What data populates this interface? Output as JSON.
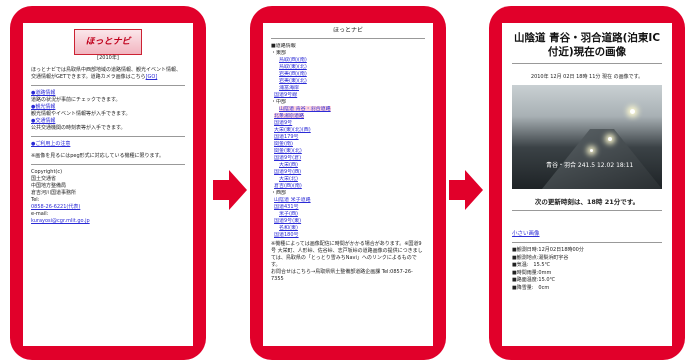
{
  "phone1": {
    "logo_text": "ほっとナビ",
    "date": "[2010年]",
    "intro": "ほっとナビでは鳥取県中西部地域の道路情報、観光イベント情報、交通情報がGETできます。道路カメラ画像はこちら",
    "intro_link": "[GO]",
    "items": [
      {
        "head": "●道路情報",
        "text": "道路の状況が事前にチェックできます。"
      },
      {
        "head": "●観光情報",
        "text": "観光情報やイベント情報等が入手できます。"
      },
      {
        "head": "●交通情報",
        "text": "公共交通機関の時刻表等が入手できます。"
      }
    ],
    "notice_link": "●ご利用上の注意",
    "note": "※画像を見るにはpeg形式に対応している機種に限ります。",
    "copyright_label": "Copyright(c)",
    "org": [
      "国土交通省",
      "中国地方整備局",
      "倉吉河川国道事務所"
    ],
    "tel_label": "Tel:",
    "tel": "0858-26-6221(代表)",
    "email_label": "e-mail:",
    "email": "kurayosi@cgr.mlit.go.jp"
  },
  "phone2": {
    "title": "ほっとナビ",
    "lines": [
      {
        "t": "■道路情報",
        "link": false,
        "indent": 0,
        "sel": false
      },
      {
        "t": "・東部",
        "link": false,
        "indent": 0,
        "sel": false
      },
      {
        "t": "鳥取(西)(南)",
        "link": true,
        "indent": 2,
        "sel": false
      },
      {
        "t": "鳥取(東)(北)",
        "link": true,
        "indent": 2,
        "sel": false
      },
      {
        "t": "岩美(西)(南)",
        "link": true,
        "indent": 2,
        "sel": false
      },
      {
        "t": "岩美(東)(北)",
        "link": true,
        "indent": 2,
        "sel": false
      },
      {
        "t": "浦富海岸",
        "link": true,
        "indent": 2,
        "sel": false
      },
      {
        "t": "国道9号線",
        "link": true,
        "indent": 1,
        "sel": false
      },
      {
        "t": "・中部",
        "link": false,
        "indent": 0,
        "sel": false
      },
      {
        "t": "山陰道 青谷・羽合道路",
        "link": true,
        "indent": 2,
        "sel": true
      },
      {
        "t": "北条湯原道路",
        "link": true,
        "indent": 1,
        "sel": true
      },
      {
        "t": "国道9号",
        "link": true,
        "indent": 1,
        "sel": false
      },
      {
        "t": "大栄(東)(北)(西)",
        "link": true,
        "indent": 1,
        "sel": false
      },
      {
        "t": "国道179号",
        "link": true,
        "indent": 1,
        "sel": false
      },
      {
        "t": "関金(南)",
        "link": true,
        "indent": 1,
        "sel": false
      },
      {
        "t": "関金(東)(北)",
        "link": true,
        "indent": 1,
        "sel": false
      },
      {
        "t": "国道9号(倉)",
        "link": true,
        "indent": 1,
        "sel": false
      },
      {
        "t": "大栄(西)",
        "link": true,
        "indent": 2,
        "sel": false
      },
      {
        "t": "国道9号(西)",
        "link": true,
        "indent": 1,
        "sel": false
      },
      {
        "t": "大栄(北)",
        "link": true,
        "indent": 2,
        "sel": false
      },
      {
        "t": "倉吉(西)(南)",
        "link": true,
        "indent": 1,
        "sel": false
      },
      {
        "t": "・西部",
        "link": false,
        "indent": 0,
        "sel": false
      },
      {
        "t": "山陰道 米子道路",
        "link": true,
        "indent": 1,
        "sel": false
      },
      {
        "t": "国道431号",
        "link": true,
        "indent": 1,
        "sel": false
      },
      {
        "t": "米子(西)",
        "link": true,
        "indent": 2,
        "sel": false
      },
      {
        "t": "国道9号(東)",
        "link": true,
        "indent": 1,
        "sel": false
      },
      {
        "t": "名和(東)",
        "link": true,
        "indent": 2,
        "sel": false
      },
      {
        "t": "国道180号",
        "link": true,
        "indent": 1,
        "sel": false
      }
    ],
    "note": "※機種によっては画像配信に時間がかかる場合があります。※国道9号 大栄町、人形峠、佐谷峠、志戸坂峠の道路画像の提供につきましては、鳥取県の「とっとり雪みちNavi」へのリンクによるものです。",
    "contact": "お問合せはこちら→鳥取県県土整備部道路企画課 Tel:0857-26-7355"
  },
  "phone3": {
    "title": "山陰道 青谷・羽合道路(泊東IC付近)現在の画像",
    "timestamp": "2010年 12月 02日 18時 11分 現在 の画像です。",
    "cam_stamp": "青谷・羽合 241.5 12.02 18:11",
    "next_update": "次の更新時刻は、18時 21分です。",
    "small_link": "小さい画像",
    "info": [
      "■観測日時:12月02日18時00分",
      "■観測地点:湯梨浜町宇谷",
      "■気温:　15.5℃",
      "■時間雨量:0mm",
      "■路面温度:15.0℃",
      "■降雪量:　0cm"
    ]
  }
}
